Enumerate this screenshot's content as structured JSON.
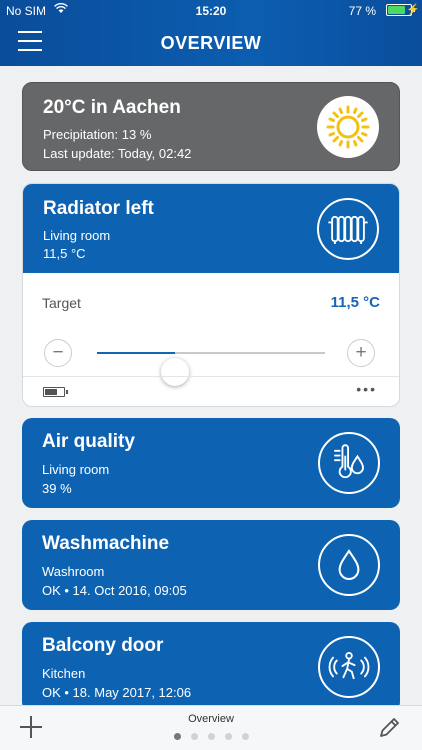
{
  "status_bar": {
    "carrier": "No SIM",
    "time": "15:20",
    "battery": "77 %",
    "battery_level": 0.77
  },
  "nav": {
    "title": "OVERVIEW"
  },
  "weather": {
    "title": "20°C in Aachen",
    "precipitation": "Precipitation: 13 %",
    "last_update": "Last update: Today, 02:42",
    "icon": "sun-icon"
  },
  "radiator": {
    "title": "Radiator left",
    "room": "Living room",
    "temperature": "11,5 °C",
    "icon": "radiator-icon",
    "target_label": "Target",
    "target_value": "11,5 °C",
    "slider_level": 0.34,
    "minus": "−",
    "plus": "+",
    "more": "•••",
    "device_battery_level": 0.65
  },
  "air_quality": {
    "title": "Air quality",
    "room": "Living room",
    "value": "39 %",
    "icon": "thermometer-humidity-icon"
  },
  "washmachine": {
    "title": "Washmachine",
    "room": "Washroom",
    "status": "OK • 14. Oct 2016, 09:05",
    "icon": "water-drop-icon"
  },
  "balcony_door": {
    "title": "Balcony door",
    "room": "Kitchen",
    "status": "OK • 18. May 2017, 12:06",
    "icon": "motion-person-icon"
  },
  "bottom_bar": {
    "page_label": "Overview",
    "page_count": 5,
    "active_page": 0
  },
  "colors": {
    "header": "#0c5db0",
    "card_blue": "#0d63b2",
    "weather_card": "#666768",
    "accent": "#1565b5",
    "sun": "#f4c10f"
  }
}
